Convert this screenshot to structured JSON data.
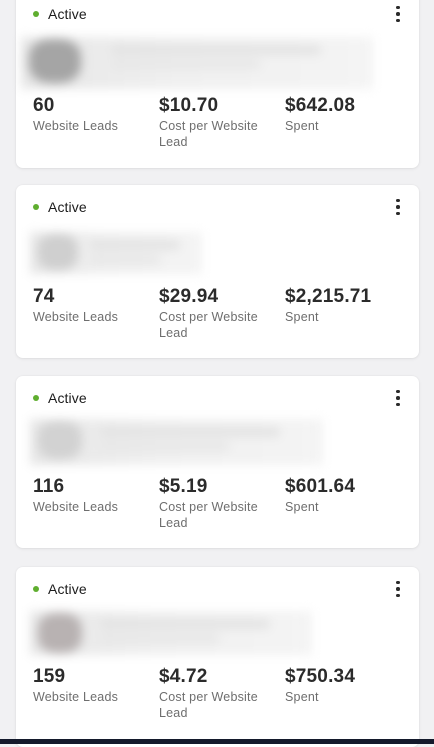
{
  "status_color": "#5fae2f",
  "campaigns": [
    {
      "status": "Active",
      "metrics": [
        {
          "value": "60",
          "label": "Website Leads"
        },
        {
          "value": "$10.70",
          "label": "Cost per Website Lead"
        },
        {
          "value": "$642.08",
          "label": "Spent"
        }
      ]
    },
    {
      "status": "Active",
      "metrics": [
        {
          "value": "74",
          "label": "Website Leads"
        },
        {
          "value": "$29.94",
          "label": "Cost per Website Lead"
        },
        {
          "value": "$2,215.71",
          "label": "Spent"
        }
      ]
    },
    {
      "status": "Active",
      "metrics": [
        {
          "value": "116",
          "label": "Website Leads"
        },
        {
          "value": "$5.19",
          "label": "Cost per Website Lead"
        },
        {
          "value": "$601.64",
          "label": "Spent"
        }
      ]
    },
    {
      "status": "Active",
      "metrics": [
        {
          "value": "159",
          "label": "Website Leads"
        },
        {
          "value": "$4.72",
          "label": "Cost per Website Lead"
        },
        {
          "value": "$750.34",
          "label": "Spent"
        }
      ]
    }
  ]
}
